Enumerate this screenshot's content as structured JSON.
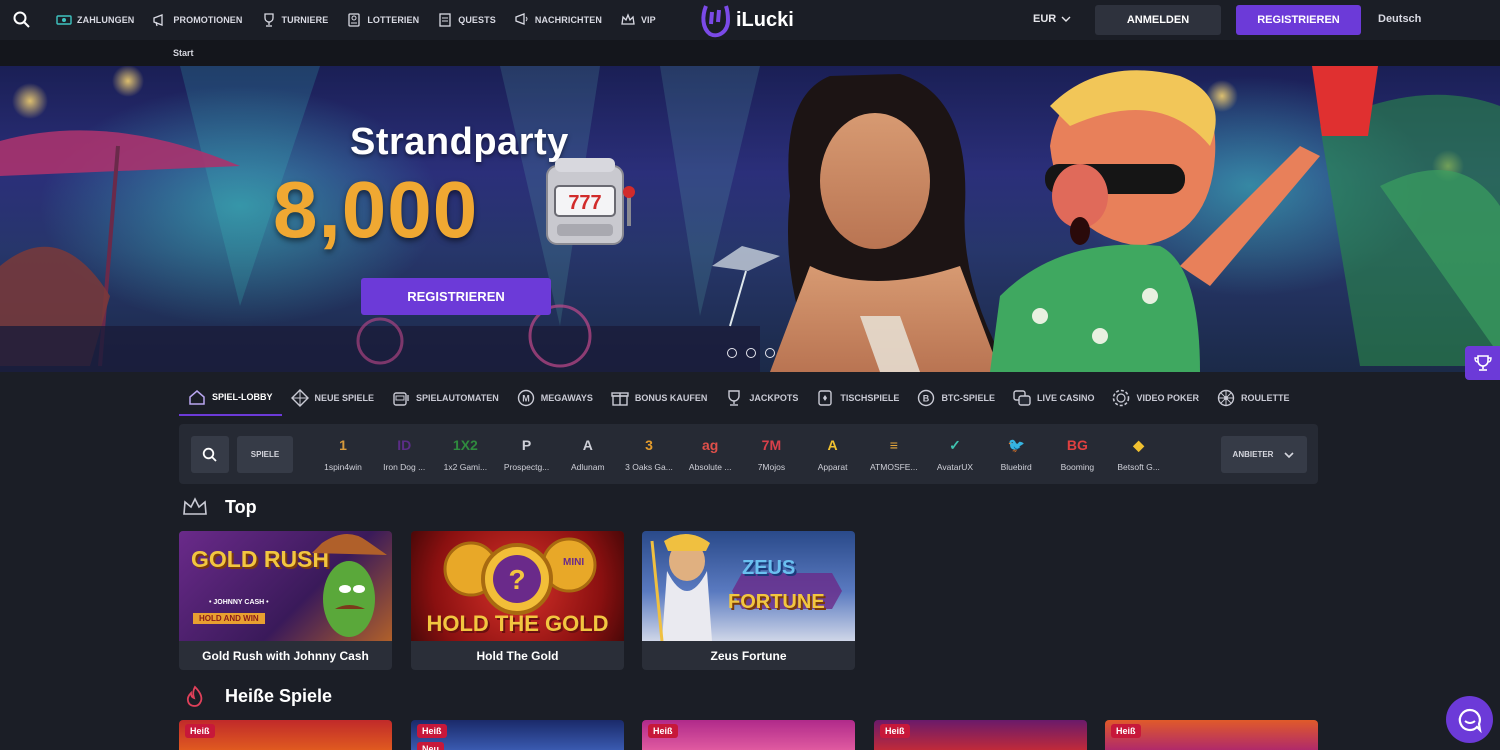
{
  "topnav": {
    "items": [
      {
        "label": "ZAHLUNGEN",
        "icon": "money-icon"
      },
      {
        "label": "PROMOTIONEN",
        "icon": "megaphone-icon"
      },
      {
        "label": "TURNIERE",
        "icon": "trophy-icon"
      },
      {
        "label": "LOTTERIEN",
        "icon": "lottery-icon"
      },
      {
        "label": "QUESTS",
        "icon": "quest-icon"
      },
      {
        "label": "NACHRICHTEN",
        "icon": "message-icon"
      },
      {
        "label": "VIP",
        "icon": "crown-icon"
      }
    ],
    "logo_text": "iLucki",
    "currency": "EUR",
    "login_label": "ANMELDEN",
    "register_label": "REGISTRIEREN",
    "language": "Deutsch"
  },
  "breadcrumb": {
    "current": "Start"
  },
  "hero": {
    "title": "Strandparty",
    "amount": "8,000",
    "slot_symbol": "777",
    "cta_label": "REGISTRIEREN",
    "slides": 3
  },
  "categories": [
    {
      "label": "SPIEL-LOBBY",
      "icon": "home-icon",
      "active": true
    },
    {
      "label": "NEUE SPIELE",
      "icon": "diamond-icon"
    },
    {
      "label": "SPIELAUTOMATEN",
      "icon": "slot-icon"
    },
    {
      "label": "MEGAWAYS",
      "icon": "megaways-icon"
    },
    {
      "label": "BONUS KAUFEN",
      "icon": "gift-icon"
    },
    {
      "label": "JACKPOTS",
      "icon": "jackpot-trophy-icon"
    },
    {
      "label": "TISCHSPIELE",
      "icon": "cards-icon"
    },
    {
      "label": "BTC-SPIELE",
      "icon": "bitcoin-icon"
    },
    {
      "label": "LIVE CASINO",
      "icon": "live-casino-icon"
    },
    {
      "label": "VIDEO POKER",
      "icon": "poker-chip-icon"
    },
    {
      "label": "ROULETTE",
      "icon": "roulette-icon"
    }
  ],
  "provider_bar": {
    "games_label": "SPIELE",
    "providers_label": "ANBIETER",
    "providers": [
      {
        "name": "1spin4win",
        "mark": "1",
        "color": "#d79a3c"
      },
      {
        "name": "Iron Dog ...",
        "mark": "ID",
        "color": "#5a2d86"
      },
      {
        "name": "1x2 Gami...",
        "mark": "1X2",
        "color": "#2f8a3e"
      },
      {
        "name": "Prospectg...",
        "mark": "P",
        "color": "#cfd0d8"
      },
      {
        "name": "Adlunam",
        "mark": "A",
        "color": "#cfd0d8"
      },
      {
        "name": "3 Oaks Ga...",
        "mark": "3",
        "color": "#e39b2c"
      },
      {
        "name": "Absolute ...",
        "mark": "ag",
        "color": "#e0504a"
      },
      {
        "name": "7Mojos",
        "mark": "7M",
        "color": "#d8404a"
      },
      {
        "name": "Apparat",
        "mark": "A",
        "color": "#f2c230"
      },
      {
        "name": "ATMOSFE...",
        "mark": "≡",
        "color": "#e7a73a"
      },
      {
        "name": "AvatarUX",
        "mark": "✓",
        "color": "#3fc3b0"
      },
      {
        "name": "Bluebird",
        "mark": "🐦",
        "color": "#3a7ad8"
      },
      {
        "name": "Booming",
        "mark": "BG",
        "color": "#e04040"
      },
      {
        "name": "Betsoft G...",
        "mark": "◆",
        "color": "#f0c030"
      }
    ]
  },
  "top_section": {
    "title": "Top",
    "games": [
      {
        "name": "Gold Rush with Johnny Cash",
        "art": "GOLD RUSH",
        "art_sub": "• JOHNNY CASH •",
        "art_sub2": "HOLD AND WIN"
      },
      {
        "name": "Hold The Gold",
        "art": "HOLD THE GOLD",
        "art_sub": "MINI"
      },
      {
        "name": "Zeus Fortune",
        "art": "ZEUS",
        "art_sub": "FORTUNE"
      }
    ]
  },
  "hot_section": {
    "title": "Heiße Spiele",
    "badge": "Heiß",
    "badge_new": "Neu"
  }
}
